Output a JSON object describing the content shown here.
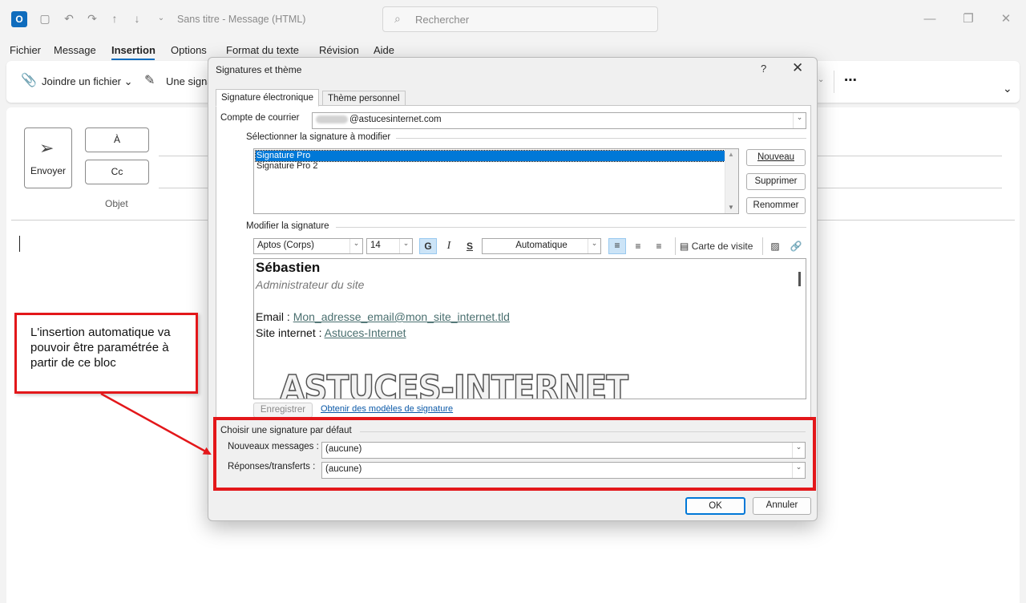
{
  "window": {
    "title": "Sans titre  -  Message (HTML)",
    "search_placeholder": "Rechercher",
    "app_icon_letter": "O"
  },
  "menu": {
    "items": [
      "Fichier",
      "Message",
      "Insertion",
      "Options",
      "Format du texte",
      "Révision",
      "Aide"
    ],
    "active": "Insertion"
  },
  "ribbon": {
    "attach_label": "Joindre un fichier",
    "signature_label": "Une signa"
  },
  "compose": {
    "send_label": "Envoyer",
    "to_label": "À",
    "cc_label": "Cc",
    "subject_label": "Objet"
  },
  "dialog": {
    "title": "Signatures et thème",
    "help": "?",
    "tabs": [
      "Signature électronique",
      "Thème personnel"
    ],
    "account_label": "Compte de courrier",
    "account_value": "@astucesinternet.com",
    "select_group_label": "Sélectionner la signature à modifier",
    "signatures": [
      "Signature Pro",
      "Signature Pro 2"
    ],
    "selected_signature": "Signature Pro",
    "buttons": {
      "new": "Nouveau",
      "delete": "Supprimer",
      "rename": "Renommer",
      "save": "Enregistrer",
      "ok": "OK",
      "cancel": "Annuler"
    },
    "edit_group_label": "Modifier la signature",
    "toolbar": {
      "font": "Aptos (Corps)",
      "size": "14",
      "bold": "G",
      "italic": "I",
      "underline": "S",
      "color": "Automatique",
      "business_card": "Carte de visite"
    },
    "signature_content": {
      "name": "Sébastien",
      "role": "Administrateur du site",
      "email_label": "Email : ",
      "email_value": "Mon_adresse_email@mon_site_internet.tld",
      "site_label": "Site internet : ",
      "site_value": "Astuces-Internet",
      "watermark": "ASTUCES-INTERNET"
    },
    "templates_link": "Obtenir des modèles de signature",
    "default_group_label": "Choisir une signature par défaut",
    "new_messages_label": "Nouveaux messages :",
    "new_messages_value": "(aucune)",
    "replies_label": "Réponses/transferts :",
    "replies_value": "(aucune)"
  },
  "annotation": {
    "text": "L'insertion automatique va pouvoir être paramétrée à partir de ce bloc",
    "color": "#e3171a"
  }
}
